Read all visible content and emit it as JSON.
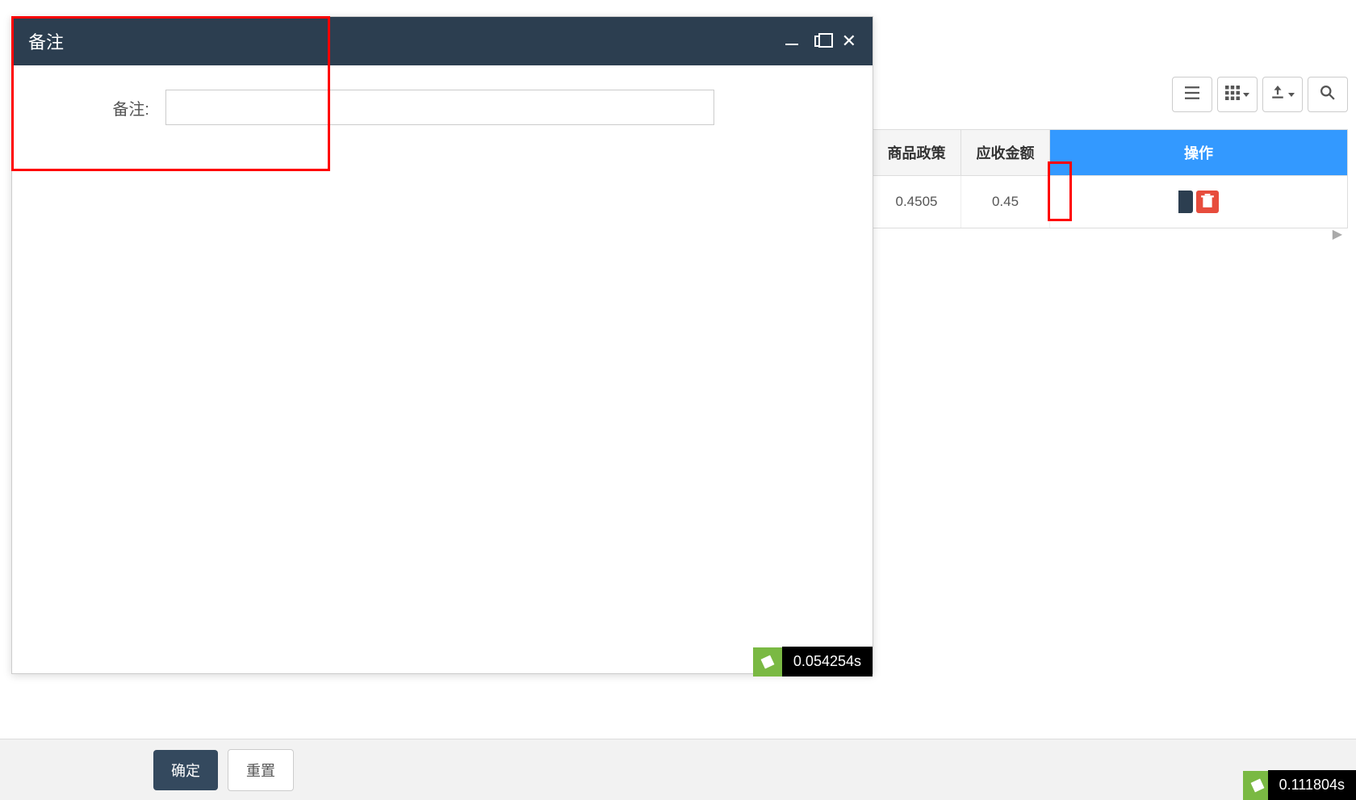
{
  "modal": {
    "title": "备注",
    "form": {
      "remark_label": "备注:",
      "remark_value": ""
    }
  },
  "toolbar": {
    "icons": {
      "list": "list-icon",
      "grid": "grid-icon",
      "export": "export-icon",
      "search": "search-icon"
    }
  },
  "table": {
    "headers": {
      "policy": "商品政策",
      "receivable": "应收金额",
      "action": "操作"
    },
    "row": {
      "policy": "0.4505",
      "receivable": "0.45"
    }
  },
  "footer": {
    "confirm_label": "确定",
    "reset_label": "重置"
  },
  "perf": {
    "inner_time": "0.054254s",
    "outer_time": "0.111804s"
  }
}
